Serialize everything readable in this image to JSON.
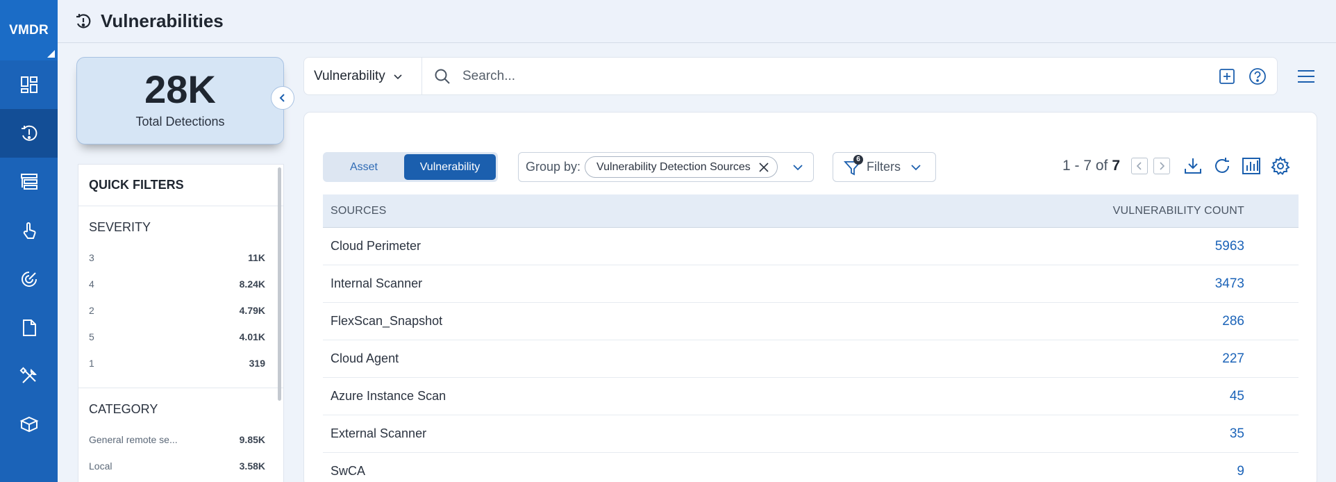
{
  "app": {
    "brand": "VMDR"
  },
  "header": {
    "title": "Vulnerabilities"
  },
  "summary": {
    "value": "28K",
    "label": "Total Detections"
  },
  "quick_filters": {
    "title": "QUICK FILTERS",
    "severity": {
      "title": "SEVERITY",
      "rows": [
        {
          "label": "3",
          "count": "11K"
        },
        {
          "label": "4",
          "count": "8.24K"
        },
        {
          "label": "2",
          "count": "4.79K"
        },
        {
          "label": "5",
          "count": "4.01K"
        },
        {
          "label": "1",
          "count": "319"
        }
      ]
    },
    "category": {
      "title": "CATEGORY",
      "rows": [
        {
          "label": "General remote se...",
          "count": "9.85K"
        },
        {
          "label": "Local",
          "count": "3.58K"
        }
      ]
    }
  },
  "search": {
    "type_select": "Vulnerability",
    "placeholder": "Search..."
  },
  "toggle": {
    "asset": "Asset",
    "vulnerability": "Vulnerability",
    "active": "Vulnerability"
  },
  "groupby": {
    "label": "Group by:",
    "chip": "Vulnerability Detection Sources"
  },
  "filters": {
    "label": "Filters",
    "badge": "6"
  },
  "pager": {
    "range": "1 - 7 of",
    "total": "7"
  },
  "table": {
    "headers": {
      "sources": "SOURCES",
      "count": "VULNERABILITY COUNT"
    },
    "rows": [
      {
        "source": "Cloud Perimeter",
        "count": "5963"
      },
      {
        "source": "Internal Scanner",
        "count": "3473"
      },
      {
        "source": "FlexScan_Snapshot",
        "count": "286"
      },
      {
        "source": "Cloud Agent",
        "count": "227"
      },
      {
        "source": "Azure Instance Scan",
        "count": "45"
      },
      {
        "source": "External Scanner",
        "count": "35"
      },
      {
        "source": "SwCA",
        "count": "9"
      }
    ]
  },
  "colors": {
    "rail": "#1b63b8",
    "accent": "#1b5fae",
    "link": "#1b63b8"
  }
}
